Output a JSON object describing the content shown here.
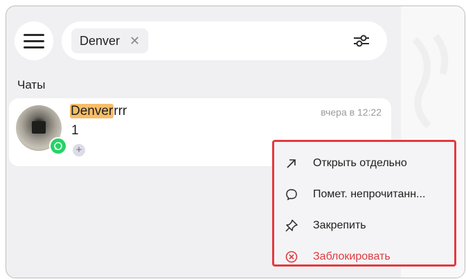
{
  "search": {
    "chip_text": "Denver"
  },
  "chats_section": {
    "title": "Чаты"
  },
  "chat_item": {
    "name_highlight": "Denver",
    "name_rest": "rrr",
    "preview": "1",
    "time": "вчера в 12:22",
    "messenger_icon": "whatsapp-icon"
  },
  "context_menu": {
    "items": [
      {
        "label": "Открыть отдельно",
        "icon": "arrow-up-right-icon"
      },
      {
        "label": "Помет. непрочитанн...",
        "icon": "chat-bubble-icon"
      },
      {
        "label": "Закрепить",
        "icon": "pin-icon"
      },
      {
        "label": "Заблокировать",
        "icon": "block-icon",
        "color": "#e03a3e"
      }
    ]
  },
  "colors": {
    "highlight": "#f6bd68",
    "menu_border": "#e23a3f",
    "danger": "#e03a3e",
    "whatsapp": "#25d366"
  }
}
